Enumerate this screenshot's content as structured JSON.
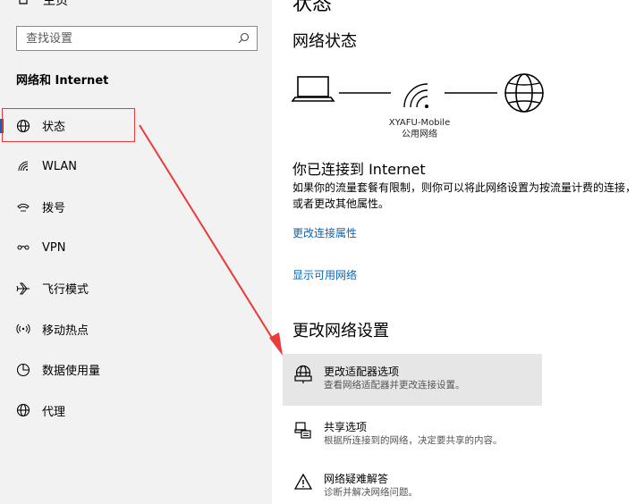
{
  "sidebar": {
    "home_label": "主页",
    "search_placeholder": "查找设置",
    "section_label": "网络和 Internet",
    "items": [
      {
        "label": "状态",
        "icon": "globe-icon"
      },
      {
        "label": "WLAN",
        "icon": "wifi-icon"
      },
      {
        "label": "拨号",
        "icon": "phone-icon"
      },
      {
        "label": "VPN",
        "icon": "vpn-icon"
      },
      {
        "label": "飞行模式",
        "icon": "airplane-icon"
      },
      {
        "label": "移动热点",
        "icon": "hotspot-icon"
      },
      {
        "label": "数据使用量",
        "icon": "data-usage-icon"
      },
      {
        "label": "代理",
        "icon": "globe-icon"
      }
    ]
  },
  "main": {
    "page_title": "状态",
    "network_status_heading": "网络状态",
    "network_name": "XYAFU-Mobile",
    "network_type": "公用网络",
    "connected_title": "你已连接到 Internet",
    "connected_desc": "如果你的流量套餐有限制，则你可以将此网络设置为按流量计费的连接，或者更改其他属性。",
    "change_props_link": "更改连接属性",
    "show_networks_link": "显示可用网络",
    "change_settings_heading": "更改网络设置",
    "options": [
      {
        "title": "更改适配器选项",
        "desc": "查看网络适配器并更改连接设置。",
        "icon": "adapter-icon"
      },
      {
        "title": "共享选项",
        "desc": "根据所连接到的网络，决定要共享的内容。",
        "icon": "sharing-icon"
      },
      {
        "title": "网络疑难解答",
        "desc": "诊断并解决网络问题。",
        "icon": "warning-icon"
      }
    ]
  },
  "colors": {
    "accent": "#0067c0",
    "annotation": "#e83b3b"
  }
}
